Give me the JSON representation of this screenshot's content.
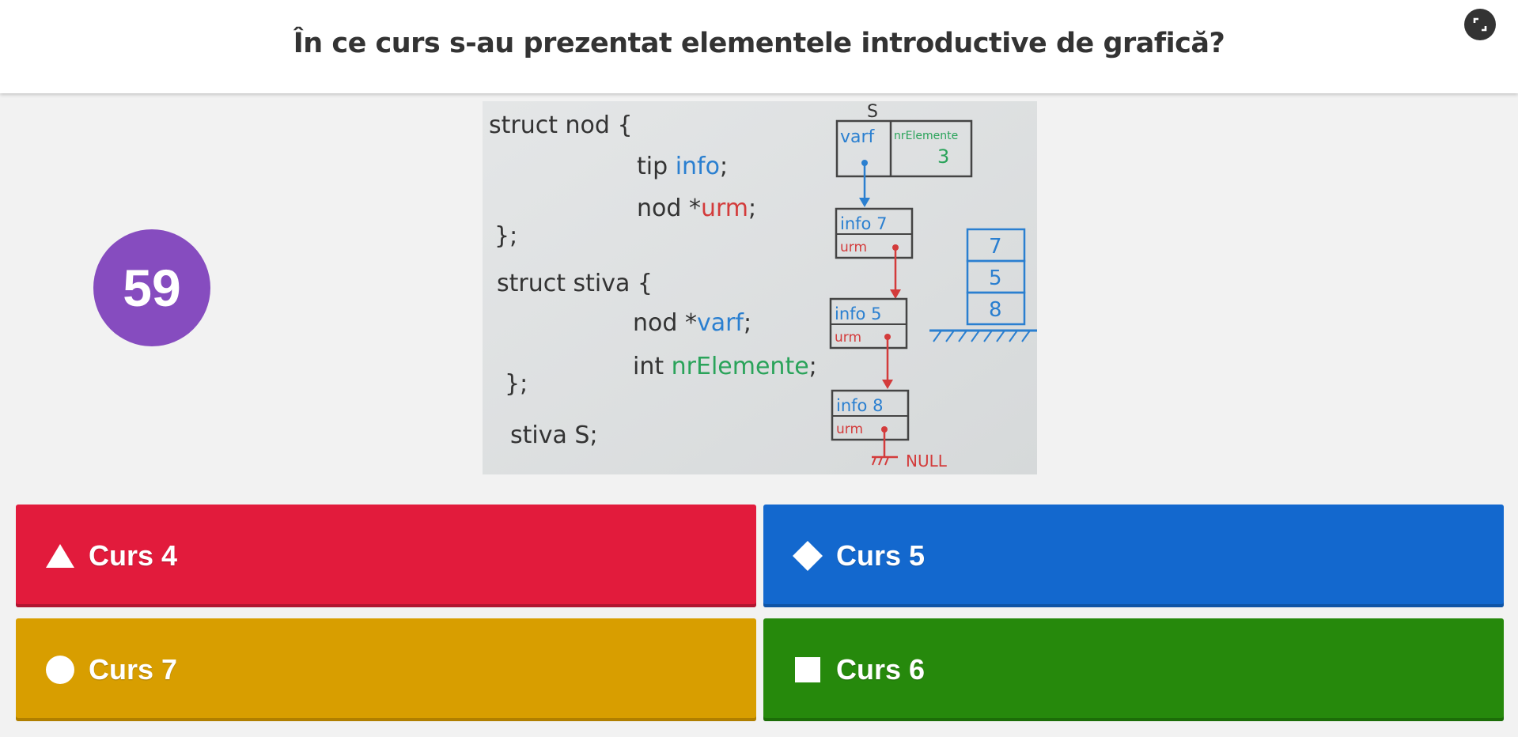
{
  "question": {
    "text": "În ce curs s-au prezentat elementele introductive de grafică?"
  },
  "timer": {
    "value": "59",
    "color": "#864cbf"
  },
  "fullscreen": {
    "icon": "fullscreen-icon"
  },
  "media": {
    "code_lines": [
      "struct nod {",
      "tip info;",
      "nod *urm;",
      "};",
      "struct stiva {",
      "nod *varf;",
      "int nrElemente;",
      "};",
      "stiva S;"
    ],
    "highlight": {
      "info": "info",
      "urm": "urm",
      "varf": "varf",
      "nrElemente": "nrElemente"
    },
    "diagram": {
      "S_label": "S",
      "head_varf": "varf",
      "head_nr": "nrElemente",
      "head_count": "3",
      "nodes": [
        {
          "info": "info",
          "value": "7",
          "urm": "urm"
        },
        {
          "info": "info",
          "value": "5",
          "urm": "urm"
        },
        {
          "info": "info",
          "value": "8",
          "urm": "urm"
        }
      ],
      "null_label": "NULL",
      "stack": [
        "7",
        "5",
        "8"
      ]
    }
  },
  "answers": [
    {
      "label": "Curs 4",
      "shape": "triangle-icon",
      "color": "#e21b3c"
    },
    {
      "label": "Curs 5",
      "shape": "diamond-icon",
      "color": "#1368ce"
    },
    {
      "label": "Curs 7",
      "shape": "circle-icon",
      "color": "#d89e00"
    },
    {
      "label": "Curs 6",
      "shape": "square-icon",
      "color": "#26890c"
    }
  ]
}
